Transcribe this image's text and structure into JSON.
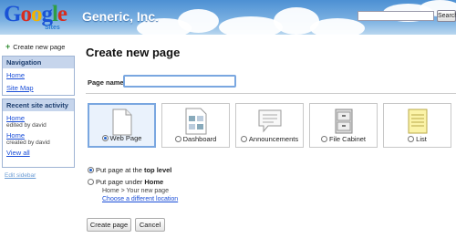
{
  "header": {
    "logo_letters": [
      "G",
      "o",
      "o",
      "g",
      "l",
      "e"
    ],
    "logo_colors": [
      "#1a53d6",
      "#d62d20",
      "#f2b300",
      "#1a53d6",
      "#2f9e44",
      "#d62d20"
    ],
    "logo_sub": "Sites",
    "site_title": "Generic, Inc.",
    "search_value": "",
    "search_button": "Search"
  },
  "sidebar": {
    "create_label": "Create new page",
    "nav_title": "Navigation",
    "nav_items": [
      "Home",
      "Site Map"
    ],
    "recent_title": "Recent site activity",
    "recent_items": [
      {
        "page": "Home",
        "detail": "edited by david"
      },
      {
        "page": "Home",
        "detail": "created by david"
      }
    ],
    "view_all": "View all",
    "edit_sidebar": "Edit sidebar"
  },
  "main": {
    "title": "Create new page",
    "page_name_label": "Page name",
    "page_name_value": "",
    "templates": [
      {
        "label": "Web Page",
        "icon": "web-page-icon",
        "selected": true
      },
      {
        "label": "Dashboard",
        "icon": "dashboard-icon",
        "selected": false
      },
      {
        "label": "Announcements",
        "icon": "announcements-icon",
        "selected": false
      },
      {
        "label": "File Cabinet",
        "icon": "file-cabinet-icon",
        "selected": false
      },
      {
        "label": "List",
        "icon": "list-icon",
        "selected": false
      }
    ],
    "location": {
      "top_level_prefix": "Put page at the ",
      "top_level_bold": "top level",
      "under_prefix": "Put page under ",
      "under_bold": "Home",
      "crumb": "Home > Your new page",
      "change_link": "Choose a different location"
    },
    "create_button": "Create page",
    "cancel_button": "Cancel"
  },
  "colors": {
    "accent": "#7aa7e0",
    "link": "#1a4ed8",
    "box_header": "#c6d5ec"
  }
}
